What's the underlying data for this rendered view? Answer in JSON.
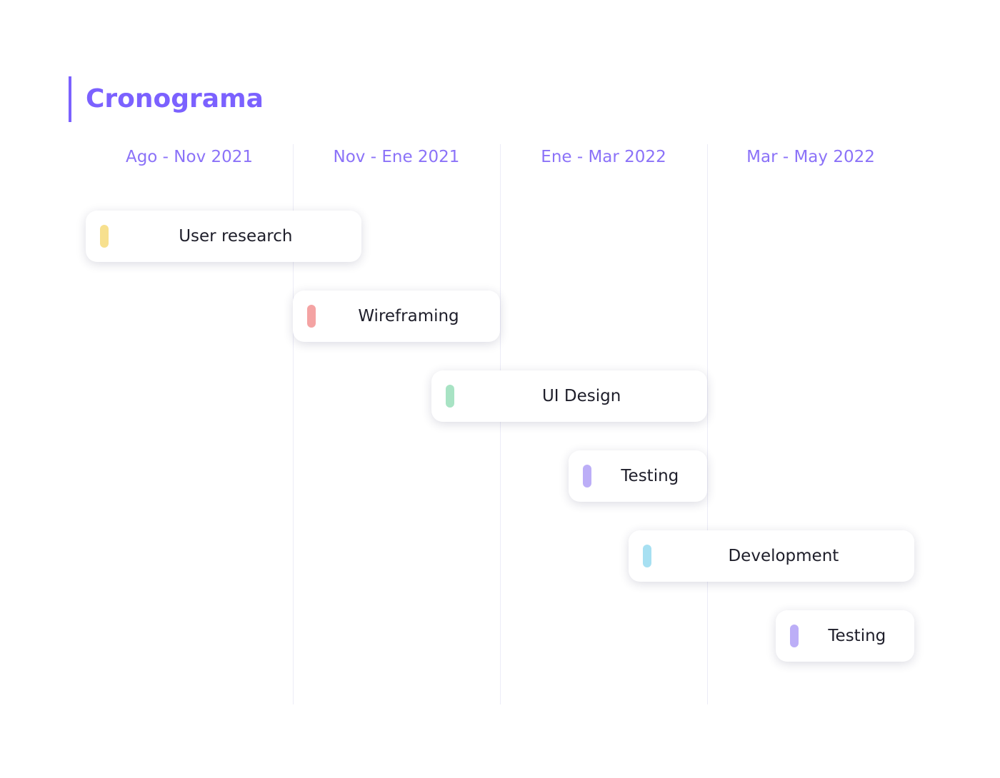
{
  "title": "Cronograma",
  "accent_color": "#7b61ff",
  "columns": [
    {
      "label": "Ago - Nov 2021"
    },
    {
      "label": "Nov - Ene 2021"
    },
    {
      "label": "Ene - Mar 2022"
    },
    {
      "label": "Mar - May 2022"
    }
  ],
  "tasks": [
    {
      "label": "User research",
      "color": "#f7e08e",
      "start": 0.0,
      "end": 1.33
    },
    {
      "label": "Wireframing",
      "color": "#f4a3a3",
      "start": 1.0,
      "end": 2.0
    },
    {
      "label": "UI Design",
      "color": "#a8e3c4",
      "start": 1.67,
      "end": 3.0
    },
    {
      "label": "Testing",
      "color": "#bcaef7",
      "start": 2.33,
      "end": 3.0
    },
    {
      "label": "Development",
      "color": "#a7e0f2",
      "start": 2.62,
      "end": 4.0
    },
    {
      "label": "Testing",
      "color": "#bcaef7",
      "start": 3.33,
      "end": 4.0
    }
  ]
}
